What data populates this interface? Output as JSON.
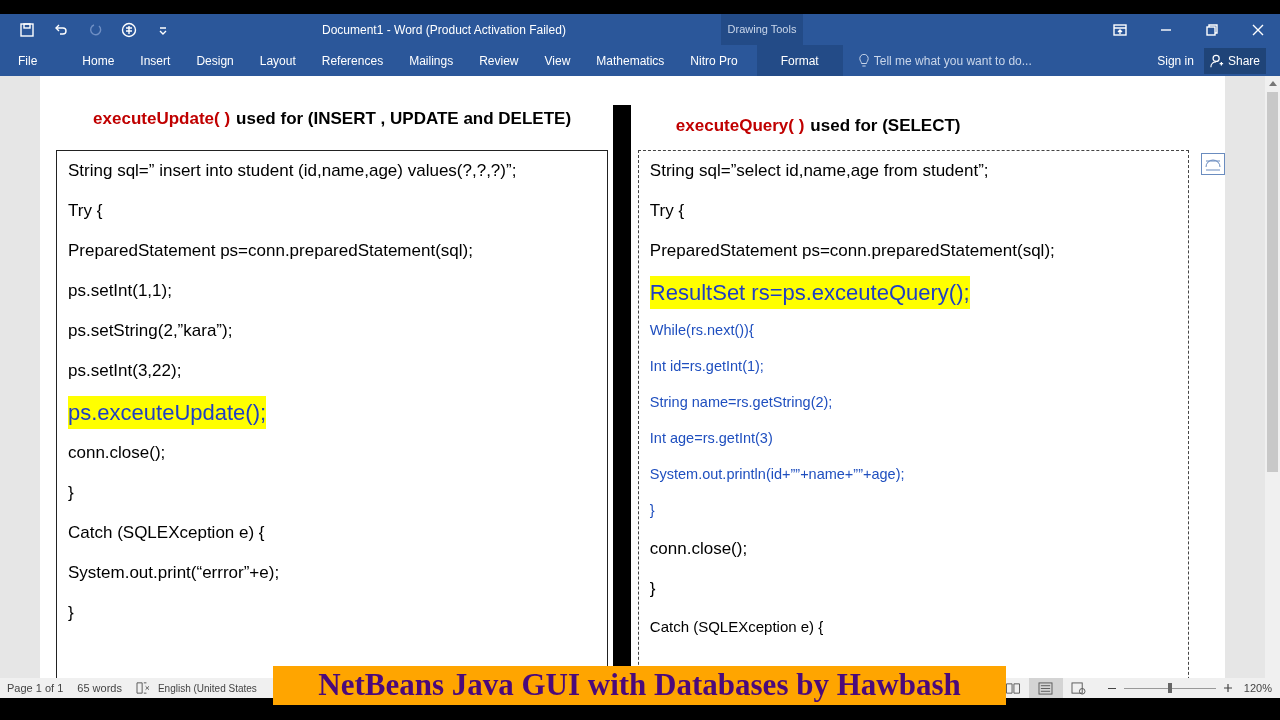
{
  "window": {
    "title": "Document1 - Word (Product Activation Failed)"
  },
  "ribbon": {
    "tabs": [
      {
        "label": "File",
        "selected": false
      },
      {
        "label": "Home",
        "selected": false
      },
      {
        "label": "Insert",
        "selected": false
      },
      {
        "label": "Design",
        "selected": false
      },
      {
        "label": "Layout",
        "selected": false
      },
      {
        "label": "References",
        "selected": false
      },
      {
        "label": "Mailings",
        "selected": false
      },
      {
        "label": "Review",
        "selected": false
      },
      {
        "label": "View",
        "selected": false
      },
      {
        "label": "Mathematics",
        "selected": false
      },
      {
        "label": "Nitro Pro",
        "selected": false
      },
      {
        "label": "Format",
        "selected": true
      }
    ],
    "contextual_group": "Drawing Tools",
    "tell_me": {
      "placeholder": "Tell me what you want to do..."
    },
    "sign_in": "Sign in",
    "share": "Share"
  },
  "document": {
    "left": {
      "heading_method": "executeUpdate( )",
      "heading_rest": "used for (INSERT , UPDATE and DELETE)",
      "lines": [
        {
          "text": "String sql=” insert into student (id,name,age) values(?,?,?)”;",
          "kind": "normal"
        },
        {
          "text": "Try {",
          "kind": "normal"
        },
        {
          "text": "PreparedStatement ps=conn.preparedStatement(sql);",
          "kind": "normal"
        },
        {
          "text": "ps.setInt(1,1);",
          "kind": "normal"
        },
        {
          "text": "ps.setString(2,”kara”);",
          "kind": "normal"
        },
        {
          "text": "ps.setInt(3,22);",
          "kind": "normal"
        },
        {
          "text": "ps.exceuteUpdate();",
          "kind": "highlight"
        },
        {
          "text": "conn.close();",
          "kind": "normal"
        },
        {
          "text": "}",
          "kind": "normal"
        },
        {
          "text": "Catch (SQLEXception e) {",
          "kind": "normal"
        },
        {
          "text": "System.out.print(“errror”+e);",
          "kind": "normal"
        },
        {
          "text": "}",
          "kind": "normal"
        }
      ]
    },
    "right": {
      "heading_method": "executeQuery( )",
      "heading_rest": "used for (SELECT)",
      "lines": [
        {
          "text": "String sql=”select id,name,age from student”;",
          "kind": "normal"
        },
        {
          "text": "Try {",
          "kind": "normal"
        },
        {
          "text": "PreparedStatement ps=conn.preparedStatement(sql);",
          "kind": "normal"
        },
        {
          "text": "ResultSet rs=ps.exceuteQuery();",
          "kind": "highlight"
        },
        {
          "text": "While(rs.next()){",
          "kind": "blue"
        },
        {
          "text": "Int id=rs.getInt(1);",
          "kind": "blue"
        },
        {
          "text": "String name=rs.getString(2);",
          "kind": "blue"
        },
        {
          "text": "Int age=rs.getInt(3)",
          "kind": "blue"
        },
        {
          "text": "System.out.println(id+””+name+””+age);",
          "kind": "blue"
        },
        {
          "text": "}",
          "kind": "blue"
        },
        {
          "text": "conn.close();",
          "kind": "normal"
        },
        {
          "text": "}",
          "kind": "normal"
        },
        {
          "text": "Catch (SQLEXception e) {",
          "kind": "small"
        }
      ]
    }
  },
  "status_bar": {
    "page": "Page 1 of 1",
    "words": "65 words",
    "language": "English (United States",
    "zoom": {
      "level": 0.5,
      "reading": "120%"
    }
  },
  "banner": "NetBeans Java GUI with Databases by Hawbash"
}
